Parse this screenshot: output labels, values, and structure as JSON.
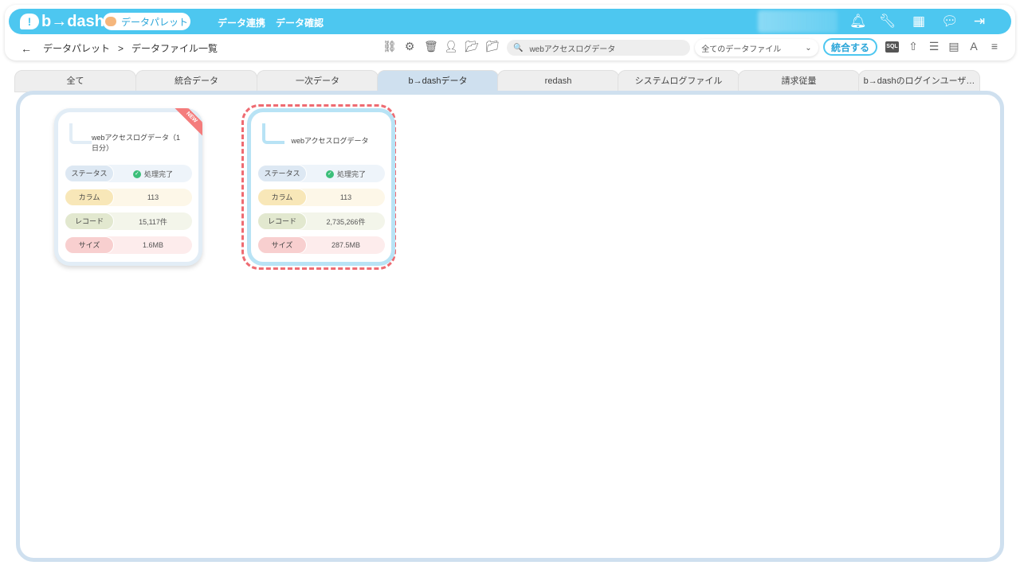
{
  "app": {
    "logo_text": "b→dash",
    "logo_mark": "!"
  },
  "topbar": {
    "palette_label": "データパレット",
    "nav": [
      "データ連携",
      "データ確認"
    ],
    "icons": [
      "bell-icon",
      "wrench-icon",
      "grid-icon",
      "chat-icon",
      "logout-icon"
    ]
  },
  "breadcrumb": {
    "back": "←",
    "items": [
      "データパレット",
      ">",
      "データファイル一覧"
    ]
  },
  "toolbar": {
    "search_value": "webアクセスログデータ",
    "search_icon": "🔍",
    "filter_value": "全てのデータファイル",
    "merge_label": "統合する",
    "sql_label": "SQL"
  },
  "tabs": [
    "全て",
    "統合データ",
    "一次データ",
    "b→dashデータ",
    "redash",
    "システムログファイル",
    "請求従量",
    "b→dashのログインユーザ…"
  ],
  "active_tab": "b→dashデータ",
  "cards": [
    {
      "title": "webアクセスログデータ（1日分）",
      "badge": "NEW",
      "status_label": "ステータス",
      "status_value": "処理完了",
      "column_label": "カラム",
      "column_value": "113",
      "record_label": "レコード",
      "record_value": "15,117件",
      "size_label": "サイズ",
      "size_value": "1.6MB"
    },
    {
      "title": "webアクセスログデータ",
      "status_label": "ステータス",
      "status_value": "処理完了",
      "column_label": "カラム",
      "column_value": "113",
      "record_label": "レコード",
      "record_value": "2,735,266件",
      "size_label": "サイズ",
      "size_value": "287.5MB"
    }
  ],
  "colors": {
    "accent": "#4dc7f0",
    "tab_active": "#cfe0ef",
    "highlight": "#ee6b72",
    "status_ok": "#3cbf7a"
  }
}
